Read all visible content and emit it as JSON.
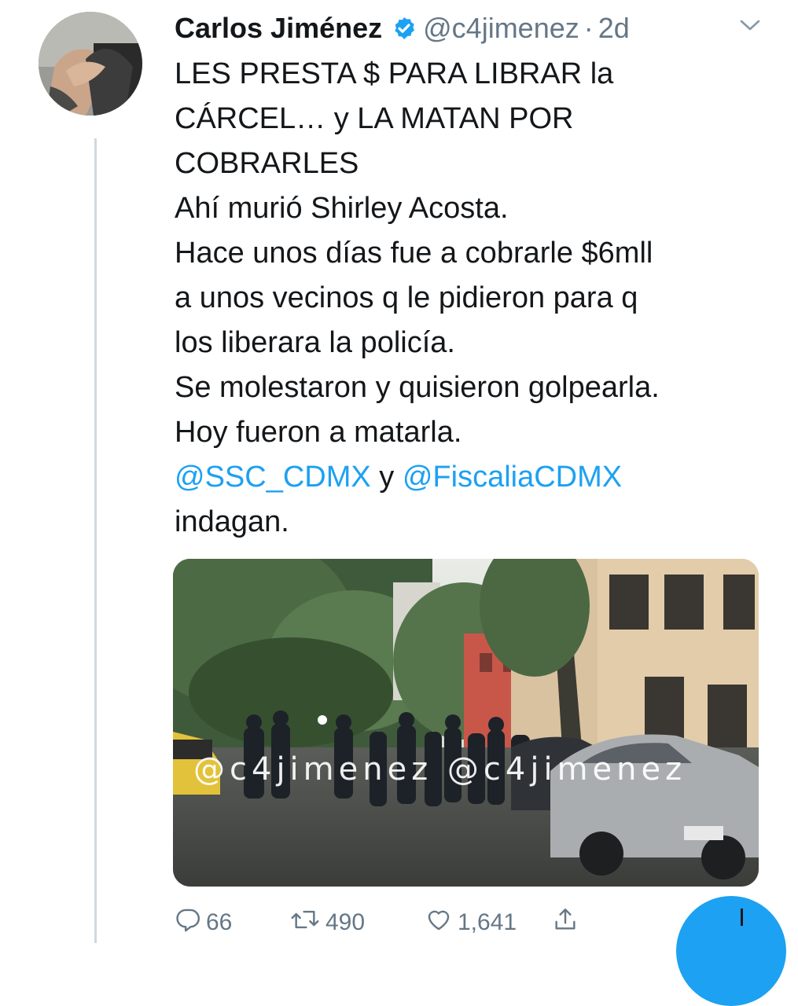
{
  "tweet": {
    "author_name": "Carlos Jiménez",
    "handle": "@c4jimenez",
    "separator": "·",
    "time": "2d",
    "lines": [
      "LES PRESTA $ PARA LIBRAR la",
      "CÁRCEL… y LA MATAN POR",
      "COBRARLES",
      "Ahí murió Shirley Acosta.",
      "Hace unos días fue a cobrarle $6mll",
      "a unos vecinos q le pidieron para q",
      "los liberara la policía.",
      "Se molestaron y quisieron golpearla.",
      "Hoy fueron a matarla."
    ],
    "mention_1": "@SSC_CDMX",
    "connector": " y ",
    "mention_2": "@FiscaliaCDMX",
    "last_line": "indagan.",
    "media_watermark": "@c4jimenez @c4jimenez"
  },
  "actions": {
    "replies": "66",
    "retweets": "490",
    "likes": "1,641"
  },
  "icons": {
    "verified": "verified-badge-icon",
    "chevron": "chevron-down-icon",
    "reply": "reply-icon",
    "retweet": "retweet-icon",
    "like": "heart-icon",
    "share": "share-icon"
  },
  "colors": {
    "link": "#1da1f2",
    "secondary_text": "#657786",
    "primary_text": "#14171a"
  }
}
